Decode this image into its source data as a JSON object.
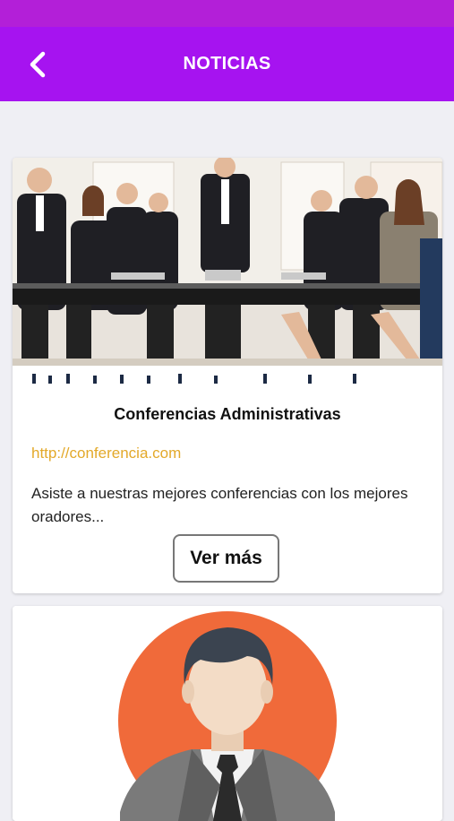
{
  "header": {
    "title": "NOTICIAS",
    "back_icon": "chevron-left-icon"
  },
  "news": [
    {
      "image": "business-meeting-photo",
      "title": "Conferencias Administrativas",
      "link": "http://conferencia.com",
      "description": "Asiste a nuestras mejores conferencias con los mejores oradores...",
      "button_label": "Ver más"
    },
    {
      "image": "businessman-avatar-illustration"
    }
  ],
  "colors": {
    "status_bar": "#b31fd8",
    "header": "#a613f0",
    "link": "#e3a92a",
    "avatar_circle": "#f06a3a"
  }
}
